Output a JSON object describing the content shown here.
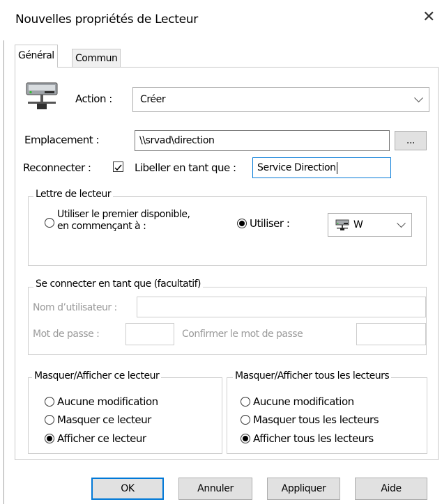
{
  "window": {
    "title": "Nouvelles propriétés de Lecteur",
    "close_glyph": "✕"
  },
  "tabs": [
    {
      "label": "Général",
      "active": true
    },
    {
      "label": "Commun",
      "active": false
    }
  ],
  "action": {
    "label": "Action :",
    "value": "Créer"
  },
  "location": {
    "label": "Emplacement :",
    "value": "\\\\srvad\\direction",
    "browse_label": "..."
  },
  "reconnect": {
    "label": "Reconnecter :",
    "checked": true
  },
  "label_as": {
    "label": "Libeller en tant que :",
    "value": "Service Direction"
  },
  "drive_letter": {
    "legend": "Lettre de lecteur",
    "option_first_line1": "Utiliser le premier disponible,",
    "option_first_line2": "en commençant à :",
    "option_use": "Utiliser :",
    "selected": "use",
    "drive_value": "W"
  },
  "connect_as": {
    "legend": "Se connecter en tant que (facultatif)",
    "username_label": "Nom d’utilisateur :",
    "username_value": "",
    "password_label": "Mot de passe :",
    "confirm_label": "Confirmer le mot de passe"
  },
  "hide_show_drive": {
    "legend": "Masquer/Afficher ce lecteur",
    "options": [
      "Aucune modification",
      "Masquer ce lecteur",
      "Afficher ce lecteur"
    ],
    "selected_index": 2
  },
  "hide_show_all": {
    "legend": "Masquer/Afficher tous les lecteurs",
    "options": [
      "Aucune modification",
      "Masquer tous les lecteurs",
      "Afficher tous les lecteurs"
    ],
    "selected_index": 2
  },
  "buttons": {
    "ok": "OK",
    "cancel": "Annuler",
    "apply": "Appliquer",
    "help": "Aide"
  },
  "colors": {
    "accent": "#0078d7",
    "disabled_text": "#9a9a9a"
  }
}
